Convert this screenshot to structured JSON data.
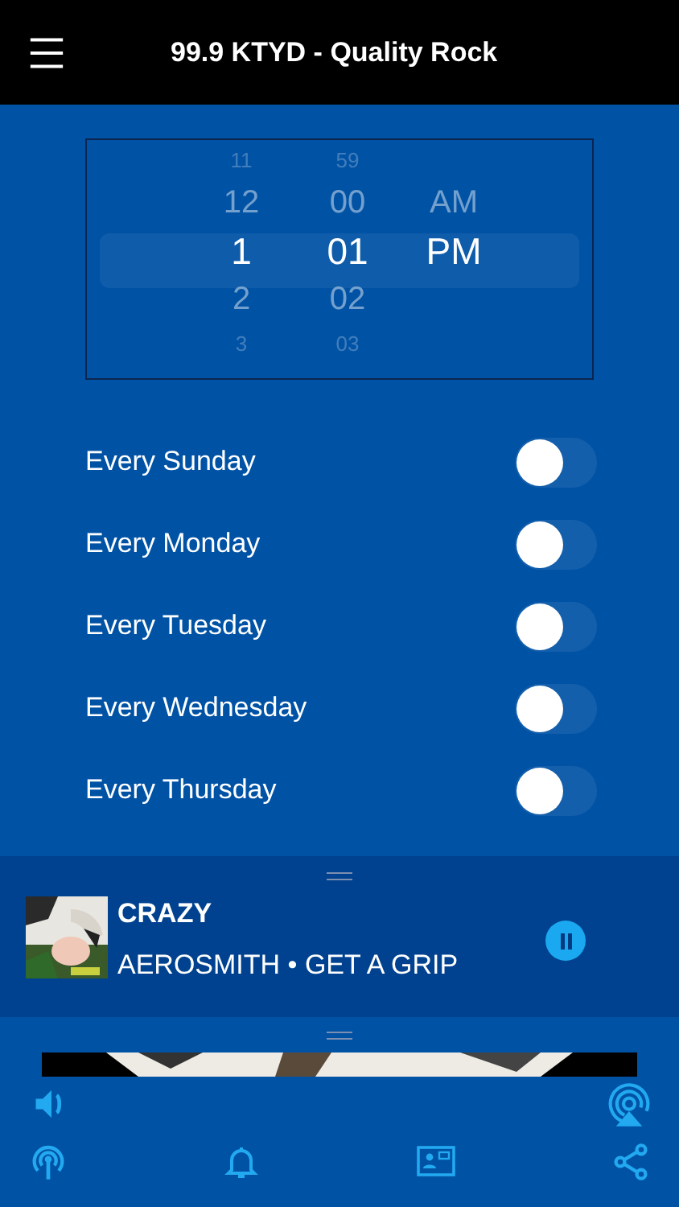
{
  "header": {
    "title": "99.9 KTYD - Quality Rock"
  },
  "time_picker": {
    "columns": [
      {
        "items": [
          {
            "label": "11",
            "selected": false
          },
          {
            "label": "12",
            "selected": false
          },
          {
            "label": "1",
            "selected": true
          },
          {
            "label": "2",
            "selected": false
          },
          {
            "label": "3",
            "selected": false
          }
        ]
      },
      {
        "items": [
          {
            "label": "59",
            "selected": false
          },
          {
            "label": "00",
            "selected": false
          },
          {
            "label": "01",
            "selected": true
          },
          {
            "label": "02",
            "selected": false
          },
          {
            "label": "03",
            "selected": false
          }
        ]
      },
      {
        "items": [
          {
            "label": "AM",
            "selected": false
          },
          {
            "label": "PM",
            "selected": true
          }
        ]
      }
    ]
  },
  "days": [
    {
      "label": "Every Sunday",
      "on": false
    },
    {
      "label": "Every Monday",
      "on": false
    },
    {
      "label": "Every Tuesday",
      "on": false
    },
    {
      "label": "Every Wednesday",
      "on": false
    },
    {
      "label": "Every Thursday",
      "on": false
    }
  ],
  "now_playing": {
    "title": "CRAZY",
    "subtitle": "AEROSMITH • GET A GRIP",
    "playing": true
  }
}
